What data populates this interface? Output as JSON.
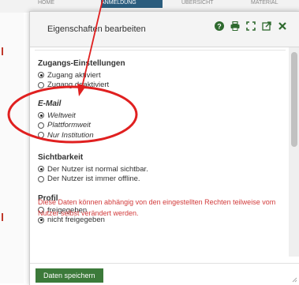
{
  "background": {
    "tabs": [
      "HOME",
      "ANMELDUNG",
      "ÜBERSICHT",
      "MATERIAL"
    ]
  },
  "dialog": {
    "title": "Eigenschaften bearbeiten",
    "toolbar_icons": [
      "help-icon",
      "print-icon",
      "expand-icon",
      "popout-icon",
      "close-icon"
    ],
    "sections": [
      {
        "title": "Zugangs-Einstellungen",
        "options": [
          {
            "label": "Zugang aktiviert",
            "checked": true
          },
          {
            "label": "Zugang deaktiviert",
            "checked": false
          }
        ]
      },
      {
        "title": "E-Mail",
        "options": [
          {
            "label": "Weltweit",
            "checked": true
          },
          {
            "label": "Plattformweit",
            "checked": false
          },
          {
            "label": "Nur Institution",
            "checked": false
          }
        ]
      },
      {
        "title": "Sichtbarkeit",
        "options": [
          {
            "label": "Der Nutzer ist normal sichtbar.",
            "checked": true
          },
          {
            "label": "Der Nutzer ist immer offline.",
            "checked": false
          }
        ]
      },
      {
        "title": "Profil",
        "options": [
          {
            "label": "freigegeben",
            "checked": false
          },
          {
            "label": "nicht freigegeben",
            "checked": true
          }
        ]
      }
    ],
    "notice": "Diese Daten können abhängig von den eingestellten Rechten teilweise vom Nutzer selbst verändert werden.",
    "save_label": "Daten speichern"
  },
  "colors": {
    "notice": "#d23b3b",
    "save_button": "#3c7a3a",
    "annotation": "#e02020"
  }
}
